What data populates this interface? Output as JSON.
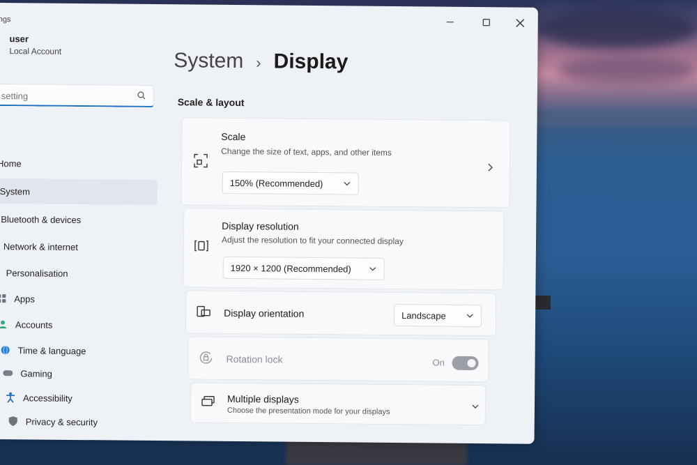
{
  "app": {
    "title": "ngs"
  },
  "window": {
    "minimize": "—",
    "maximize": "☐",
    "close": "✕"
  },
  "account": {
    "name": "user",
    "type": "Local Account"
  },
  "search": {
    "placeholder": "setting"
  },
  "nav": {
    "items": [
      {
        "label": "Home",
        "icon": "home-icon"
      },
      {
        "label": "System",
        "icon": "system-icon",
        "selected": true
      },
      {
        "label": "Bluetooth & devices",
        "icon": "bluetooth-icon"
      },
      {
        "label": "Network & internet",
        "icon": "network-icon"
      },
      {
        "label": "Personalisation",
        "icon": "brush-icon"
      },
      {
        "label": "Apps",
        "icon": "apps-icon"
      },
      {
        "label": "Accounts",
        "icon": "accounts-icon"
      },
      {
        "label": "Time & language",
        "icon": "globe-icon"
      },
      {
        "label": "Gaming",
        "icon": "controller-icon"
      },
      {
        "label": "Accessibility",
        "icon": "accessibility-icon"
      },
      {
        "label": "Privacy & security",
        "icon": "shield-icon"
      }
    ]
  },
  "breadcrumb": {
    "parent": "System",
    "separator": "›",
    "current": "Display"
  },
  "section": {
    "title": "Scale & layout"
  },
  "scale": {
    "title": "Scale",
    "description": "Change the size of text, apps, and other items",
    "value": "150% (Recommended)"
  },
  "resolution": {
    "title": "Display resolution",
    "description": "Adjust the resolution to fit your connected display",
    "value": "1920 × 1200 (Recommended)"
  },
  "orientation": {
    "title": "Display orientation",
    "value": "Landscape"
  },
  "rotation_lock": {
    "title": "Rotation lock",
    "state": "On",
    "enabled": false
  },
  "multiple_displays": {
    "title": "Multiple displays",
    "description": "Choose the presentation mode for your displays"
  },
  "colors": {
    "accent": "#1d6fc0",
    "window_bg": "#eef1f6",
    "card_bg": "#f8f9fb"
  }
}
